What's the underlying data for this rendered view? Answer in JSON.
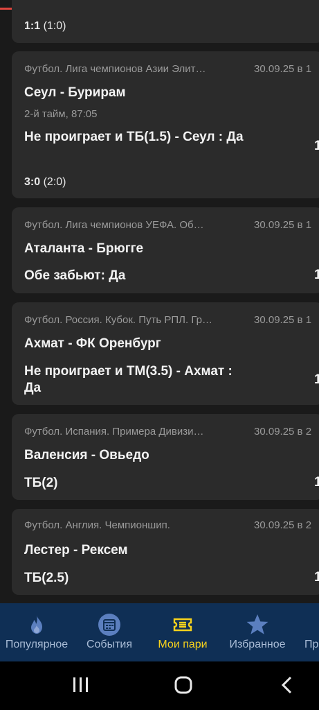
{
  "partial_card": {
    "score_main": "1:1",
    "score_half": "(1:0)"
  },
  "cards": [
    {
      "league": "Футбол. Лига чемпионов Азии Элит…",
      "date": "30.09.25 в 1",
      "match": "Сеул - Бурирам",
      "time": "2-й тайм, 87:05",
      "bet": "Не проиграет и ТБ(1.5) - Сеул : Да",
      "coef": "1",
      "score_main": "3:0",
      "score_half": "(2:0)"
    },
    {
      "league": "Футбол. Лига чемпионов УЕФА. Об…",
      "date": "30.09.25 в 1",
      "match": "Аталанта - Брюгге",
      "bet": "Обе забьют: Да",
      "coef": "1"
    },
    {
      "league": "Футбол. Россия. Кубок. Путь РПЛ. Гр…",
      "date": "30.09.25 в 1",
      "match": "Ахмат - ФК Оренбург",
      "bet": "Не проиграет и ТМ(3.5) - Ахмат : Да",
      "coef": "1"
    },
    {
      "league": "Футбол. Испания. Примера Дивизи…",
      "date": "30.09.25 в 2",
      "match": "Валенсия - Овьедо",
      "bet": "ТБ(2)",
      "coef": "1"
    },
    {
      "league": "Футбол. Англия. Чемпионшип.",
      "date": "30.09.25 в 2",
      "match": "Лестер - Рексем",
      "bet": "ТБ(2.5)",
      "coef": "1"
    }
  ],
  "nav": {
    "items": [
      {
        "label": "Популярное",
        "icon": "flame-icon"
      },
      {
        "label": "События",
        "icon": "calendar-icon"
      },
      {
        "label": "Мои пари",
        "icon": "ticket-icon"
      },
      {
        "label": "Избранное",
        "icon": "star-icon"
      },
      {
        "label": "Пр",
        "icon": ""
      }
    ],
    "active_color": "#f7d21c",
    "inactive_color": "#a9bcd6",
    "background": "#0f2f55"
  },
  "colors": {
    "progress": "#e0463f",
    "card": "#2b2b2b",
    "page": "#1a1a1a"
  }
}
